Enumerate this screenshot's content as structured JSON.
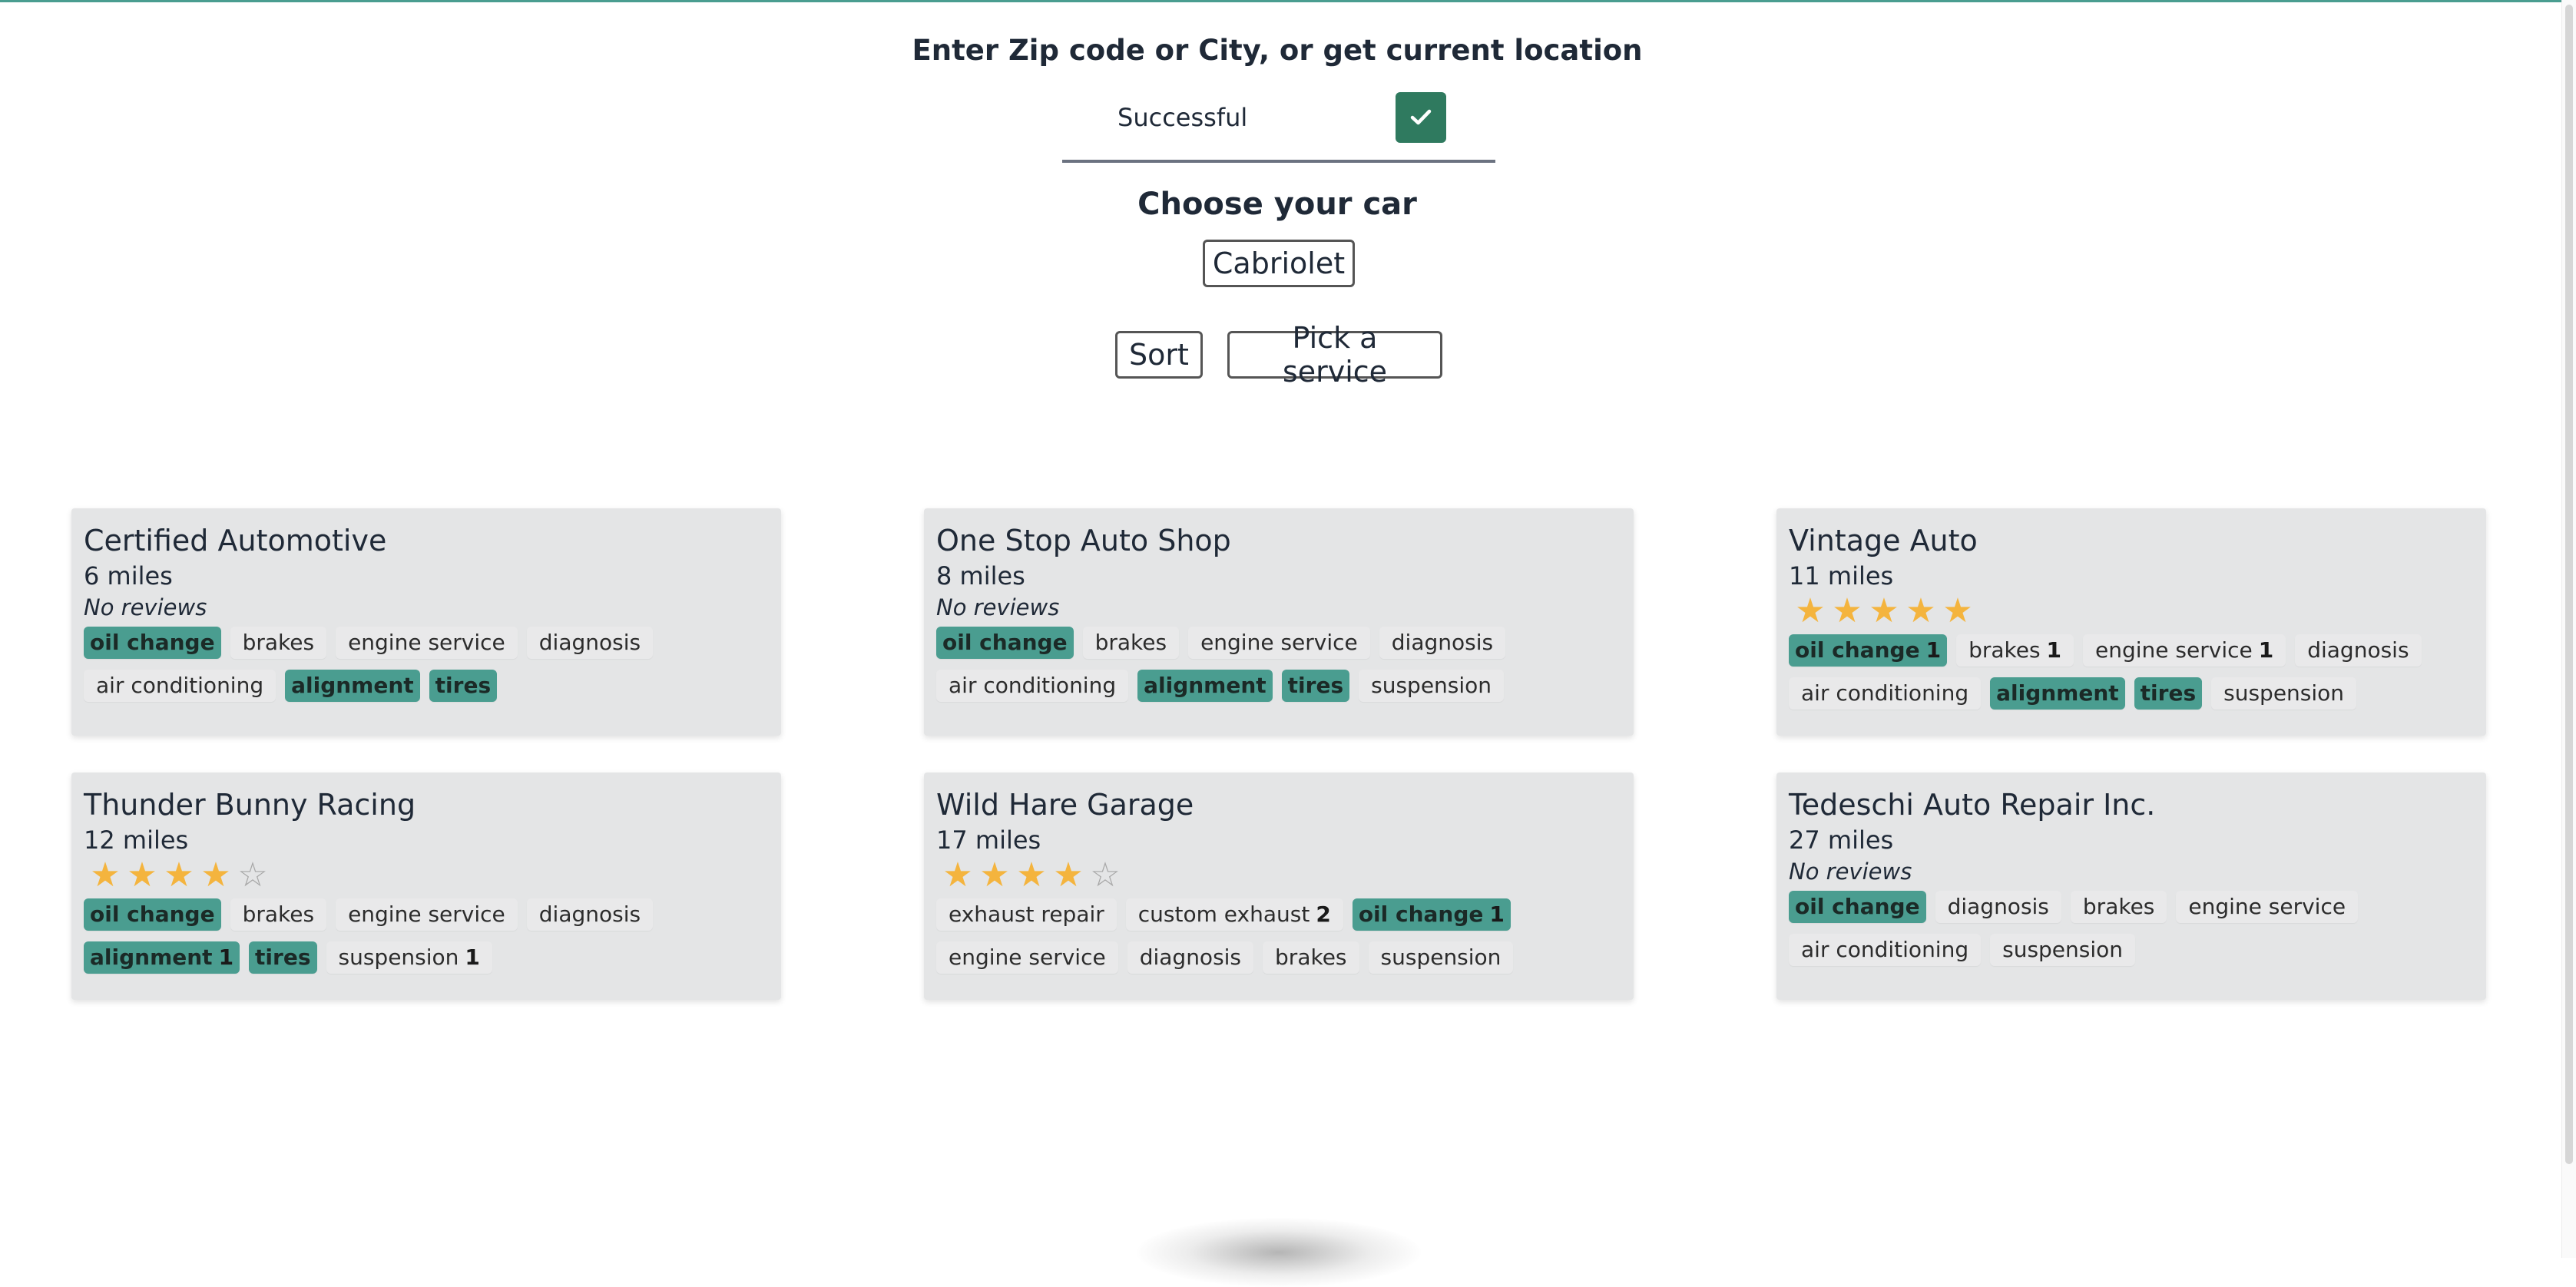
{
  "location": {
    "heading": "Enter Zip code or City, or get current location",
    "input_value": "Successful",
    "submit_icon": "check-icon"
  },
  "car": {
    "heading": "Choose your car",
    "selected": "Cabriolet"
  },
  "controls": {
    "sort_label": "Sort",
    "service_label": "Pick a service"
  },
  "colors": {
    "accent": "#4a9d90",
    "submit": "#2f7a5f",
    "star": "#f4b43e",
    "card_bg": "#e4e5e6"
  },
  "shops": [
    {
      "name": "Certified Automotive",
      "distance": "6 miles",
      "reviews": "No reviews",
      "rating": null,
      "tags": [
        {
          "label": "oil change",
          "highlight": true
        },
        {
          "label": "brakes",
          "highlight": false
        },
        {
          "label": "engine service",
          "highlight": false
        },
        {
          "label": "diagnosis",
          "highlight": false
        },
        {
          "label": "air conditioning",
          "highlight": false
        },
        {
          "label": "alignment",
          "highlight": true
        },
        {
          "label": "tires",
          "highlight": true
        }
      ]
    },
    {
      "name": "One Stop Auto Shop",
      "distance": "8 miles",
      "reviews": "No reviews",
      "rating": null,
      "tags": [
        {
          "label": "oil change",
          "highlight": true
        },
        {
          "label": "brakes",
          "highlight": false
        },
        {
          "label": "engine service",
          "highlight": false
        },
        {
          "label": "diagnosis",
          "highlight": false
        },
        {
          "label": "air conditioning",
          "highlight": false
        },
        {
          "label": "alignment",
          "highlight": true
        },
        {
          "label": "tires",
          "highlight": true
        },
        {
          "label": "suspension",
          "highlight": false
        }
      ]
    },
    {
      "name": "Vintage Auto",
      "distance": "11 miles",
      "reviews": "",
      "rating": 5,
      "tags": [
        {
          "label": "oil change",
          "highlight": true,
          "count": "1"
        },
        {
          "label": "brakes",
          "highlight": false,
          "count": "1"
        },
        {
          "label": "engine service",
          "highlight": false,
          "count": "1"
        },
        {
          "label": "diagnosis",
          "highlight": false
        },
        {
          "label": "air conditioning",
          "highlight": false
        },
        {
          "label": "alignment",
          "highlight": true
        },
        {
          "label": "tires",
          "highlight": true
        },
        {
          "label": "suspension",
          "highlight": false
        }
      ]
    },
    {
      "name": "Thunder Bunny Racing",
      "distance": "12 miles",
      "reviews": "",
      "rating": 4,
      "tags": [
        {
          "label": "oil change",
          "highlight": true
        },
        {
          "label": "brakes",
          "highlight": false
        },
        {
          "label": "engine service",
          "highlight": false
        },
        {
          "label": "diagnosis",
          "highlight": false
        },
        {
          "label": "alignment",
          "highlight": true,
          "count": "1"
        },
        {
          "label": "tires",
          "highlight": true
        },
        {
          "label": "suspension",
          "highlight": false,
          "count": "1"
        }
      ]
    },
    {
      "name": "Wild Hare Garage",
      "distance": "17 miles",
      "reviews": "",
      "rating": 4,
      "tags": [
        {
          "label": "exhaust repair",
          "highlight": false
        },
        {
          "label": "custom exhaust",
          "highlight": false,
          "count": "2"
        },
        {
          "label": "oil change",
          "highlight": true,
          "count": "1"
        },
        {
          "label": "engine service",
          "highlight": false
        },
        {
          "label": "diagnosis",
          "highlight": false
        },
        {
          "label": "brakes",
          "highlight": false
        },
        {
          "label": "suspension",
          "highlight": false
        }
      ]
    },
    {
      "name": "Tedeschi Auto Repair Inc.",
      "distance": "27 miles",
      "reviews": "No reviews",
      "rating": null,
      "tags": [
        {
          "label": "oil change",
          "highlight": true
        },
        {
          "label": "diagnosis",
          "highlight": false
        },
        {
          "label": "brakes",
          "highlight": false
        },
        {
          "label": "engine service",
          "highlight": false
        },
        {
          "label": "air conditioning",
          "highlight": false
        },
        {
          "label": "suspension",
          "highlight": false
        }
      ]
    }
  ]
}
